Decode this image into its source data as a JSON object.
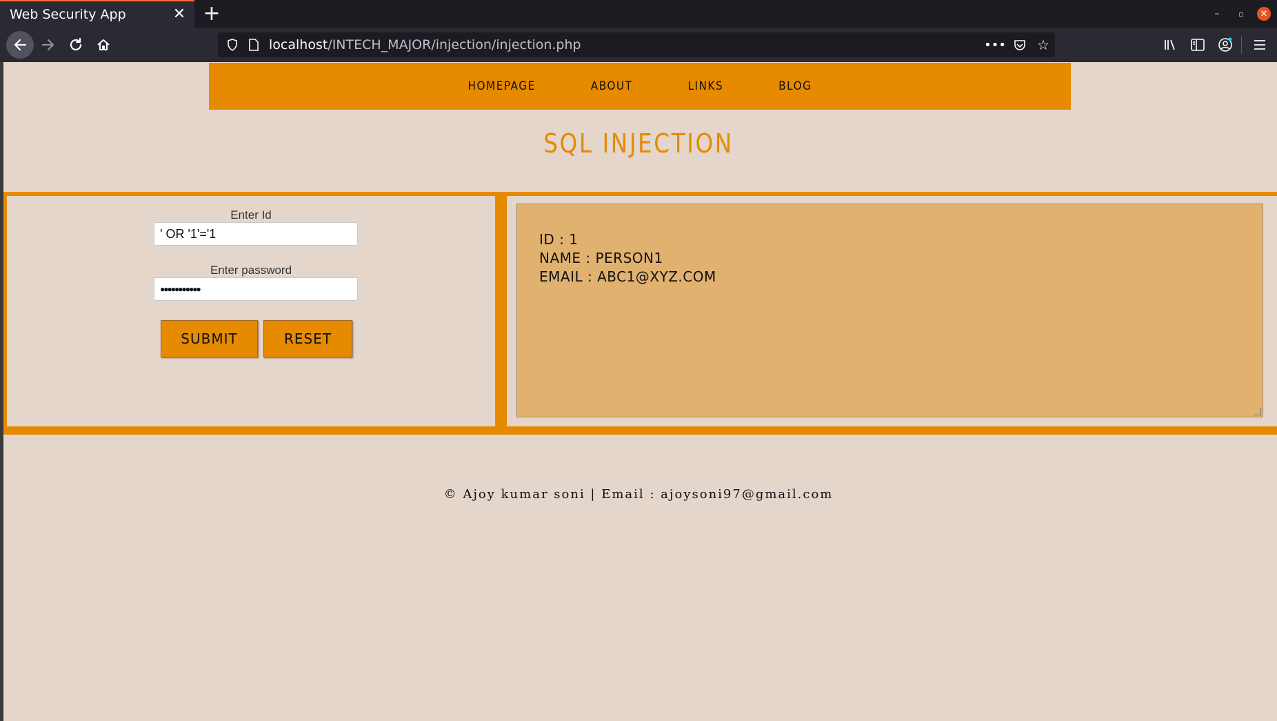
{
  "browser": {
    "tab_title": "Web Security App",
    "close_tab_glyph": "✕",
    "new_tab_glyph": "+",
    "url_host": "localhost",
    "url_path": "/INTECH_MAJOR/injection/injection.php"
  },
  "icons": {
    "back": "back-arrow-icon",
    "forward": "forward-arrow-icon",
    "reload": "reload-icon",
    "home": "home-icon",
    "shield": "tracking-protection-shield-icon",
    "page": "page-info-icon",
    "more": "more-actions-icon",
    "pocket": "pocket-icon",
    "star": "bookmark-star-icon",
    "library": "library-icon",
    "sidebar": "sidebar-icon",
    "account": "account-icon",
    "menu": "hamburger-menu-icon"
  },
  "site_nav": {
    "items": [
      "HOMEPAGE",
      "ABOUT",
      "LINKS",
      "BLOG"
    ]
  },
  "page": {
    "title": "SQL INJECTION"
  },
  "form": {
    "id_label": "Enter Id",
    "id_value": "' OR '1'='1",
    "password_label": "Enter password",
    "password_value": "●●●●●●●●●●●",
    "submit_label": "SUBMIT",
    "reset_label": "RESET"
  },
  "result": {
    "lines": [
      "ID : 1",
      "NAME : PERSON1",
      "EMAIL : ABC1@XYZ.COM"
    ]
  },
  "footer": {
    "text": "© Ajoy kumar soni | Email : ajoysoni97@gmail.com"
  },
  "colors": {
    "accent": "#e68a00",
    "page_bg": "#e4d6cb",
    "result_bg": "#e1b170"
  }
}
